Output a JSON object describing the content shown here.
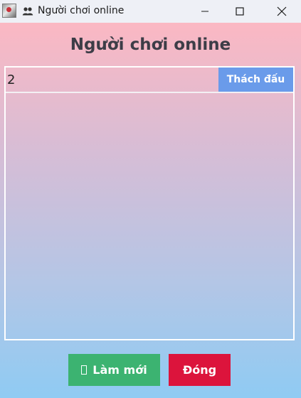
{
  "window": {
    "title": "Người chơi online"
  },
  "heading": "Người chơi online",
  "players": [
    {
      "name": "2",
      "challenge_label": "Thách đấu"
    }
  ],
  "buttons": {
    "refresh_label": "Làm mới",
    "close_label": "Đóng"
  },
  "colors": {
    "gradient_top": "#fbb8c3",
    "gradient_bottom": "#8fcbf3",
    "challenge": "#6a9bea",
    "refresh": "#3cb371",
    "close": "#dc143c",
    "heading": "#3d3d47"
  },
  "icons": {
    "app": "java-app-icon",
    "title": "people-icon",
    "refresh_glyph": "missing-glyph-box"
  }
}
